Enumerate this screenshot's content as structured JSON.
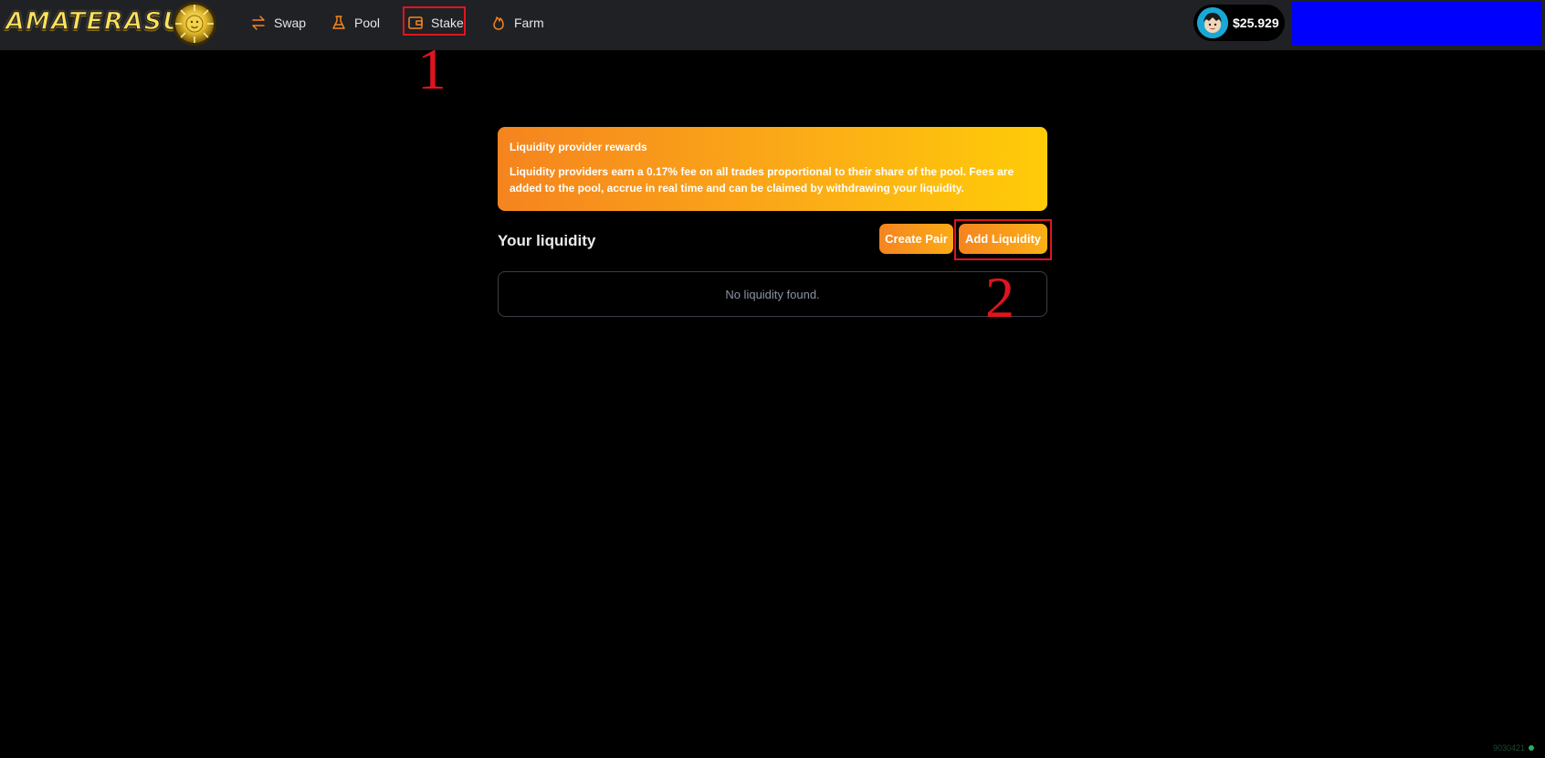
{
  "app": {
    "logo_text": "AMATERASU"
  },
  "nav": {
    "items": [
      {
        "label": "Swap",
        "icon": "swap-arrows-icon"
      },
      {
        "label": "Pool",
        "icon": "flask-icon"
      },
      {
        "label": "Stake",
        "icon": "wallet-icon"
      },
      {
        "label": "Farm",
        "icon": "flame-icon"
      }
    ]
  },
  "wallet": {
    "balance": "$25.929",
    "connect_color": "#0000ff"
  },
  "annotations": {
    "one": "1",
    "two": "2",
    "color": "#e0141e"
  },
  "info": {
    "title": "Liquidity provider rewards",
    "body": "Liquidity providers earn a 0.17% fee on all trades proportional to their share of the pool. Fees are added to the pool, accrue in real time and can be claimed by withdrawing your liquidity."
  },
  "liquidity": {
    "heading": "Your liquidity",
    "create_label": "Create Pair",
    "add_label": "Add Liquidity",
    "empty_text": "No liquidity found."
  },
  "footer": {
    "build_id": "9030421"
  },
  "colors": {
    "accent_start": "#f5841f",
    "accent_end": "#ffcc08",
    "topbar": "#1f2124"
  }
}
